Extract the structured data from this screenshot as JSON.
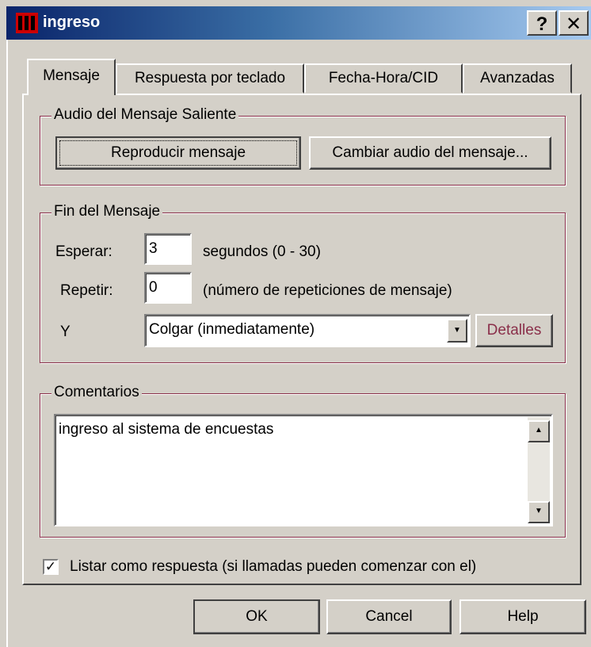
{
  "window": {
    "title": "ingreso",
    "help_label": "?",
    "close_label": "✕",
    "icon": "app-logo-icon"
  },
  "tabs": [
    {
      "label": "Mensaje",
      "active": true
    },
    {
      "label": "Respuesta por teclado",
      "active": false
    },
    {
      "label": "Fecha-Hora/CID",
      "active": false
    },
    {
      "label": "Avanzadas",
      "active": false
    }
  ],
  "audio_group": {
    "title": "Audio del Mensaje Saliente",
    "play_button": "Reproducir mensaje",
    "change_button": "Cambiar audio del mensaje..."
  },
  "end_group": {
    "title": "Fin del Mensaje",
    "wait_label": "Esperar:",
    "wait_value": "3",
    "wait_unit": "segundos (0 - 30)",
    "repeat_label": "Repetir:",
    "repeat_value": "0",
    "repeat_unit": "(número de repeticiones de mensaje)",
    "then_label": "Y",
    "then_value": "Colgar (inmediatamente)",
    "details_button": "Detalles"
  },
  "comments_group": {
    "title": "Comentarios",
    "text": "ingreso al sistema de encuestas"
  },
  "list_checkbox": {
    "checked": true,
    "label": "Listar como respuesta (si llamadas pueden comenzar con el)"
  },
  "footer": {
    "ok": "OK",
    "cancel": "Cancel",
    "help": "Help"
  },
  "colors": {
    "title_start": "#0a246a",
    "title_end": "#a6caf0",
    "face": "#d4d0c8",
    "group_border": "#8a2f4a"
  }
}
